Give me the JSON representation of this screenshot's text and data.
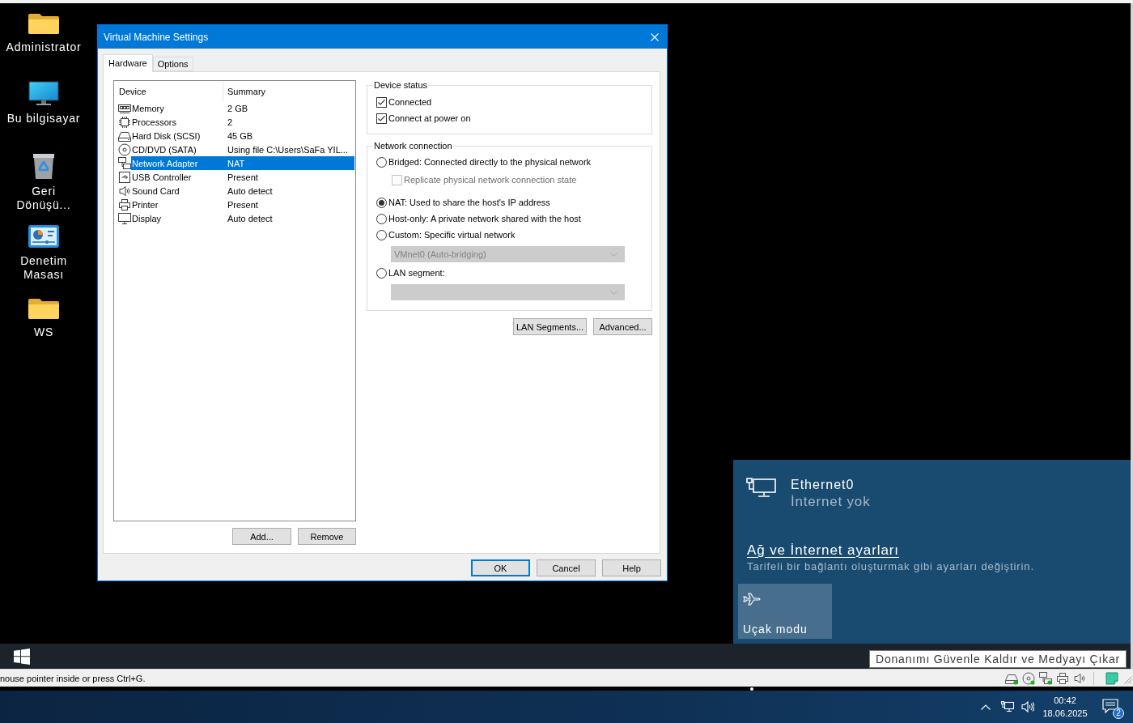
{
  "desktop": {
    "icons": [
      {
        "kind": "folder",
        "label": "Administrator"
      },
      {
        "kind": "computer",
        "label": "Bu bilgisayar"
      },
      {
        "kind": "recycle_bin",
        "label": "Geri Dönüşü..."
      },
      {
        "kind": "control_panel",
        "label": "Denetim Masası"
      },
      {
        "kind": "folder",
        "label": "WS"
      }
    ]
  },
  "dialog": {
    "title": "Virtual Machine Settings",
    "tabs": [
      {
        "label": "Hardware",
        "selected": true
      },
      {
        "label": "Options",
        "selected": false
      }
    ],
    "device_list": {
      "columns": [
        "Device",
        "Summary"
      ],
      "rows": [
        {
          "kind": "memory",
          "device": "Memory",
          "summary": "2 GB",
          "selected": false
        },
        {
          "kind": "processor",
          "device": "Processors",
          "summary": "2",
          "selected": false
        },
        {
          "kind": "hard_disk",
          "device": "Hard Disk (SCSI)",
          "summary": "45 GB",
          "selected": false
        },
        {
          "kind": "cd",
          "device": "CD/DVD (SATA)",
          "summary": "Using file C:\\Users\\SaFa YIL...",
          "selected": false
        },
        {
          "kind": "network",
          "device": "Network Adapter",
          "summary": "NAT",
          "selected": true
        },
        {
          "kind": "usb",
          "device": "USB Controller",
          "summary": "Present",
          "selected": false
        },
        {
          "kind": "sound",
          "device": "Sound Card",
          "summary": "Auto detect",
          "selected": false
        },
        {
          "kind": "printer",
          "device": "Printer",
          "summary": "Present",
          "selected": false
        },
        {
          "kind": "display",
          "device": "Display",
          "summary": "Auto detect",
          "selected": false
        }
      ]
    },
    "list_buttons": [
      "Add...",
      "Remove"
    ],
    "device_status": {
      "title": "Device status",
      "options": [
        {
          "label": "Connected",
          "checked": true
        },
        {
          "label": "Connect at power on",
          "checked": true
        }
      ]
    },
    "network_connection": {
      "title": "Network connection",
      "items": [
        {
          "kind": "radio",
          "label": "Bridged: Connected directly to the physical network",
          "selected": false
        },
        {
          "kind": "checkbox",
          "label": "Replicate physical network connection state",
          "checked": false,
          "disabled": true
        },
        {
          "kind": "radio",
          "label": "NAT: Used to share the host's IP address",
          "selected": true
        },
        {
          "kind": "radio",
          "label": "Host-only: A private network shared with the host",
          "selected": false
        },
        {
          "kind": "radio",
          "label": "Custom: Specific virtual network",
          "selected": false
        },
        {
          "kind": "dropdown",
          "value": "VMnet0 (Auto-bridging)",
          "disabled": true
        },
        {
          "kind": "radio",
          "label": "LAN segment:",
          "selected": false
        },
        {
          "kind": "dropdown",
          "disabled": true
        }
      ]
    },
    "group_buttons": [
      "LAN Segments...",
      "Advanced..."
    ],
    "footer_buttons": [
      {
        "label": "OK",
        "default": true
      },
      {
        "label": "Cancel",
        "default": false
      },
      {
        "label": "Help",
        "default": false
      }
    ]
  },
  "network_flyout": {
    "connection": {
      "name": "Ethernet0",
      "status": "İnternet yok"
    },
    "settings_link": "Ağ ve İnternet ayarları",
    "settings_hint": "Tarifeli bir bağlantı oluşturmak gibi ayarları değiştirin.",
    "quick_actions": [
      {
        "label": "Uçak modu",
        "on": false
      }
    ]
  },
  "guest_taskbar": {
    "tooltip": "Donanımı Güvenle Kaldır ve Medyayı Çıkar"
  },
  "vm_status_bar": {
    "message": "nouse pointer inside or press Ctrl+G.",
    "devices": [
      {
        "kind": "hard_disk",
        "connected": true
      },
      {
        "kind": "cd",
        "connected": true
      },
      {
        "kind": "network",
        "connected": true
      },
      {
        "kind": "printer",
        "connected": false
      },
      {
        "kind": "sound",
        "connected": false
      }
    ]
  },
  "host_taskbar": {
    "time": "00:42",
    "date": "18.06.2025",
    "notification_count": "2"
  }
}
